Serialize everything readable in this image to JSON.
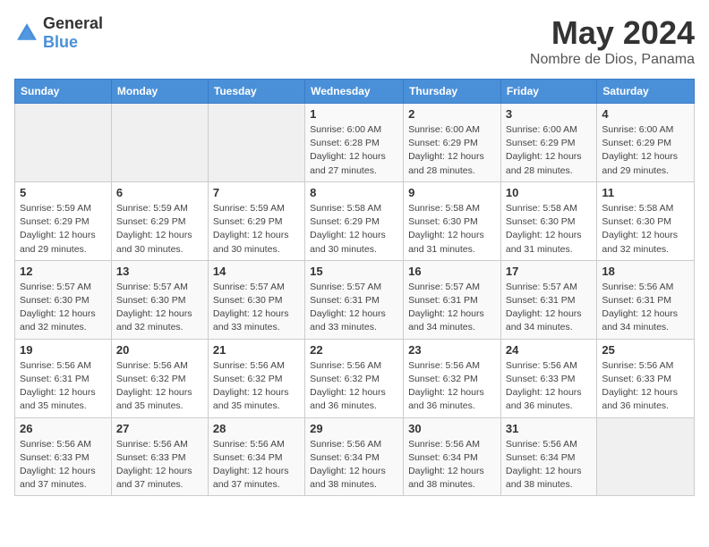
{
  "logo": {
    "general": "General",
    "blue": "Blue"
  },
  "header": {
    "title": "May 2024",
    "subtitle": "Nombre de Dios, Panama"
  },
  "weekdays": [
    "Sunday",
    "Monday",
    "Tuesday",
    "Wednesday",
    "Thursday",
    "Friday",
    "Saturday"
  ],
  "weeks": [
    [
      {
        "day": "",
        "info": ""
      },
      {
        "day": "",
        "info": ""
      },
      {
        "day": "",
        "info": ""
      },
      {
        "day": "1",
        "info": "Sunrise: 6:00 AM\nSunset: 6:28 PM\nDaylight: 12 hours and 27 minutes."
      },
      {
        "day": "2",
        "info": "Sunrise: 6:00 AM\nSunset: 6:29 PM\nDaylight: 12 hours and 28 minutes."
      },
      {
        "day": "3",
        "info": "Sunrise: 6:00 AM\nSunset: 6:29 PM\nDaylight: 12 hours and 28 minutes."
      },
      {
        "day": "4",
        "info": "Sunrise: 6:00 AM\nSunset: 6:29 PM\nDaylight: 12 hours and 29 minutes."
      }
    ],
    [
      {
        "day": "5",
        "info": "Sunrise: 5:59 AM\nSunset: 6:29 PM\nDaylight: 12 hours and 29 minutes."
      },
      {
        "day": "6",
        "info": "Sunrise: 5:59 AM\nSunset: 6:29 PM\nDaylight: 12 hours and 30 minutes."
      },
      {
        "day": "7",
        "info": "Sunrise: 5:59 AM\nSunset: 6:29 PM\nDaylight: 12 hours and 30 minutes."
      },
      {
        "day": "8",
        "info": "Sunrise: 5:58 AM\nSunset: 6:29 PM\nDaylight: 12 hours and 30 minutes."
      },
      {
        "day": "9",
        "info": "Sunrise: 5:58 AM\nSunset: 6:30 PM\nDaylight: 12 hours and 31 minutes."
      },
      {
        "day": "10",
        "info": "Sunrise: 5:58 AM\nSunset: 6:30 PM\nDaylight: 12 hours and 31 minutes."
      },
      {
        "day": "11",
        "info": "Sunrise: 5:58 AM\nSunset: 6:30 PM\nDaylight: 12 hours and 32 minutes."
      }
    ],
    [
      {
        "day": "12",
        "info": "Sunrise: 5:57 AM\nSunset: 6:30 PM\nDaylight: 12 hours and 32 minutes."
      },
      {
        "day": "13",
        "info": "Sunrise: 5:57 AM\nSunset: 6:30 PM\nDaylight: 12 hours and 32 minutes."
      },
      {
        "day": "14",
        "info": "Sunrise: 5:57 AM\nSunset: 6:30 PM\nDaylight: 12 hours and 33 minutes."
      },
      {
        "day": "15",
        "info": "Sunrise: 5:57 AM\nSunset: 6:31 PM\nDaylight: 12 hours and 33 minutes."
      },
      {
        "day": "16",
        "info": "Sunrise: 5:57 AM\nSunset: 6:31 PM\nDaylight: 12 hours and 34 minutes."
      },
      {
        "day": "17",
        "info": "Sunrise: 5:57 AM\nSunset: 6:31 PM\nDaylight: 12 hours and 34 minutes."
      },
      {
        "day": "18",
        "info": "Sunrise: 5:56 AM\nSunset: 6:31 PM\nDaylight: 12 hours and 34 minutes."
      }
    ],
    [
      {
        "day": "19",
        "info": "Sunrise: 5:56 AM\nSunset: 6:31 PM\nDaylight: 12 hours and 35 minutes."
      },
      {
        "day": "20",
        "info": "Sunrise: 5:56 AM\nSunset: 6:32 PM\nDaylight: 12 hours and 35 minutes."
      },
      {
        "day": "21",
        "info": "Sunrise: 5:56 AM\nSunset: 6:32 PM\nDaylight: 12 hours and 35 minutes."
      },
      {
        "day": "22",
        "info": "Sunrise: 5:56 AM\nSunset: 6:32 PM\nDaylight: 12 hours and 36 minutes."
      },
      {
        "day": "23",
        "info": "Sunrise: 5:56 AM\nSunset: 6:32 PM\nDaylight: 12 hours and 36 minutes."
      },
      {
        "day": "24",
        "info": "Sunrise: 5:56 AM\nSunset: 6:33 PM\nDaylight: 12 hours and 36 minutes."
      },
      {
        "day": "25",
        "info": "Sunrise: 5:56 AM\nSunset: 6:33 PM\nDaylight: 12 hours and 36 minutes."
      }
    ],
    [
      {
        "day": "26",
        "info": "Sunrise: 5:56 AM\nSunset: 6:33 PM\nDaylight: 12 hours and 37 minutes."
      },
      {
        "day": "27",
        "info": "Sunrise: 5:56 AM\nSunset: 6:33 PM\nDaylight: 12 hours and 37 minutes."
      },
      {
        "day": "28",
        "info": "Sunrise: 5:56 AM\nSunset: 6:34 PM\nDaylight: 12 hours and 37 minutes."
      },
      {
        "day": "29",
        "info": "Sunrise: 5:56 AM\nSunset: 6:34 PM\nDaylight: 12 hours and 38 minutes."
      },
      {
        "day": "30",
        "info": "Sunrise: 5:56 AM\nSunset: 6:34 PM\nDaylight: 12 hours and 38 minutes."
      },
      {
        "day": "31",
        "info": "Sunrise: 5:56 AM\nSunset: 6:34 PM\nDaylight: 12 hours and 38 minutes."
      },
      {
        "day": "",
        "info": ""
      }
    ]
  ]
}
